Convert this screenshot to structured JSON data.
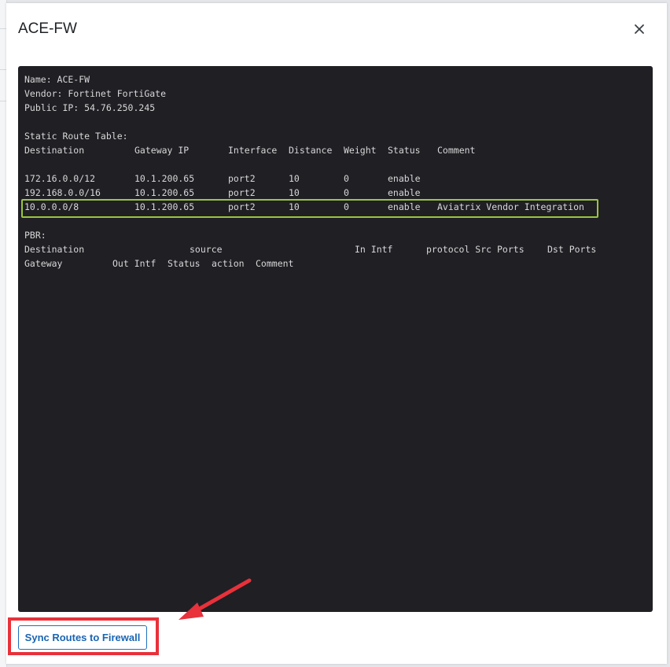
{
  "modal": {
    "title": "ACE-FW",
    "close_icon": "close-icon"
  },
  "terminal": {
    "name_line": "Name: ACE-FW",
    "vendor_line": "Vendor: Fortinet FortiGate",
    "public_ip_line": "Public IP: 54.76.250.245",
    "static_route_title": "Static Route Table:",
    "static_headers": {
      "destination": "Destination",
      "gateway_ip": "Gateway IP",
      "interface": "Interface",
      "distance": "Distance",
      "weight": "Weight",
      "status": "Status",
      "comment": "Comment"
    },
    "routes": [
      {
        "destination": "172.16.0.0/12",
        "gateway_ip": "10.1.200.65",
        "interface": "port2",
        "distance": "10",
        "weight": "0",
        "status": "enable",
        "comment": ""
      },
      {
        "destination": "192.168.0.0/16",
        "gateway_ip": "10.1.200.65",
        "interface": "port2",
        "distance": "10",
        "weight": "0",
        "status": "enable",
        "comment": ""
      },
      {
        "destination": "10.0.0.0/8",
        "gateway_ip": "10.1.200.65",
        "interface": "port2",
        "distance": "10",
        "weight": "0",
        "status": "enable",
        "comment": "Aviatrix Vendor Integration"
      }
    ],
    "pbr_title": "PBR:",
    "pbr_headers_1": {
      "destination": "Destination",
      "source": "source",
      "in_intf": "In Intf",
      "protocol_src_ports": "protocol Src Ports",
      "dst_ports": "Dst Ports"
    },
    "pbr_headers_2": {
      "gateway": "Gateway",
      "out_intf": "Out Intf",
      "status": "Status",
      "action": "action",
      "comment": "Comment"
    }
  },
  "actions": {
    "sync_label": "Sync Routes to Firewall"
  },
  "colors": {
    "terminal_bg": "#1f1f24",
    "highlight": "#9bc53d",
    "annotation": "#e8313a",
    "button_text": "#1a65b3"
  }
}
